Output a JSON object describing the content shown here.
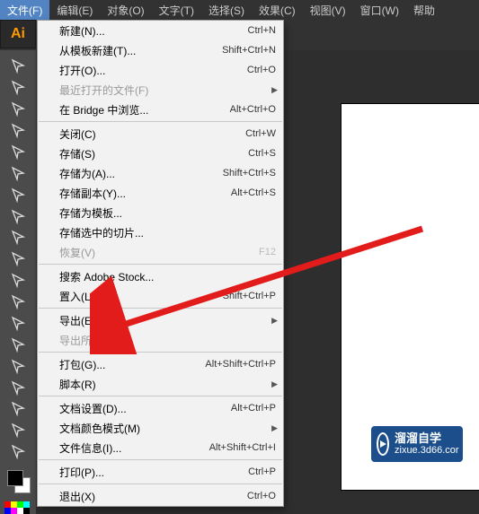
{
  "app_badge": "Ai",
  "menubar": [
    {
      "label": "文件(F)",
      "active": true
    },
    {
      "label": "编辑(E)"
    },
    {
      "label": "对象(O)"
    },
    {
      "label": "文字(T)"
    },
    {
      "label": "选择(S)"
    },
    {
      "label": "效果(C)"
    },
    {
      "label": "视图(V)"
    },
    {
      "label": "窗口(W)"
    },
    {
      "label": "帮助"
    }
  ],
  "dropdown": [
    {
      "label": "新建(N)...",
      "shortcut": "Ctrl+N"
    },
    {
      "label": "从模板新建(T)...",
      "shortcut": "Shift+Ctrl+N"
    },
    {
      "label": "打开(O)...",
      "shortcut": "Ctrl+O"
    },
    {
      "label": "最近打开的文件(F)",
      "submenu": true,
      "disabled": true
    },
    {
      "label": "在 Bridge 中浏览...",
      "shortcut": "Alt+Ctrl+O"
    },
    {
      "sep": true
    },
    {
      "label": "关闭(C)",
      "shortcut": "Ctrl+W"
    },
    {
      "label": "存储(S)",
      "shortcut": "Ctrl+S"
    },
    {
      "label": "存储为(A)...",
      "shortcut": "Shift+Ctrl+S"
    },
    {
      "label": "存储副本(Y)...",
      "shortcut": "Alt+Ctrl+S"
    },
    {
      "label": "存储为模板..."
    },
    {
      "label": "存储选中的切片..."
    },
    {
      "label": "恢复(V)",
      "shortcut": "F12",
      "disabled": true
    },
    {
      "sep": true
    },
    {
      "label": "搜索 Adobe Stock..."
    },
    {
      "label": "置入(L)...",
      "shortcut": "Shift+Ctrl+P"
    },
    {
      "sep": true
    },
    {
      "label": "导出(E)",
      "submenu": true
    },
    {
      "label": "导出所选项目...",
      "disabled": true
    },
    {
      "sep": true
    },
    {
      "label": "打包(G)...",
      "shortcut": "Alt+Shift+Ctrl+P"
    },
    {
      "label": "脚本(R)",
      "submenu": true
    },
    {
      "sep": true
    },
    {
      "label": "文档设置(D)...",
      "shortcut": "Alt+Ctrl+P"
    },
    {
      "label": "文档颜色模式(M)",
      "submenu": true
    },
    {
      "label": "文件信息(I)...",
      "shortcut": "Alt+Shift+Ctrl+I"
    },
    {
      "sep": true
    },
    {
      "label": "打印(P)...",
      "shortcut": "Ctrl+P"
    },
    {
      "sep": true
    },
    {
      "label": "退出(X)",
      "shortcut": "Ctrl+O"
    }
  ],
  "tools": [
    "selection",
    "direct-selection",
    "wand",
    "pen",
    "type",
    "line",
    "rectangle",
    "brush",
    "pencil",
    "eraser",
    "rotate",
    "scale",
    "width",
    "free-transform",
    "shape-builder",
    "mesh",
    "gradient",
    "eyedropper",
    "blend",
    "symbol",
    "graph",
    "artboard",
    "slice",
    "hand",
    "zoom"
  ],
  "palette_colors": [
    "#ff0000",
    "#ffff00",
    "#00ff00",
    "#00ffff",
    "#0000ff",
    "#ff00ff",
    "#ffffff",
    "#000000"
  ],
  "watermark": {
    "title": "溜溜自学",
    "sub": "zixue.3d66.cor"
  }
}
